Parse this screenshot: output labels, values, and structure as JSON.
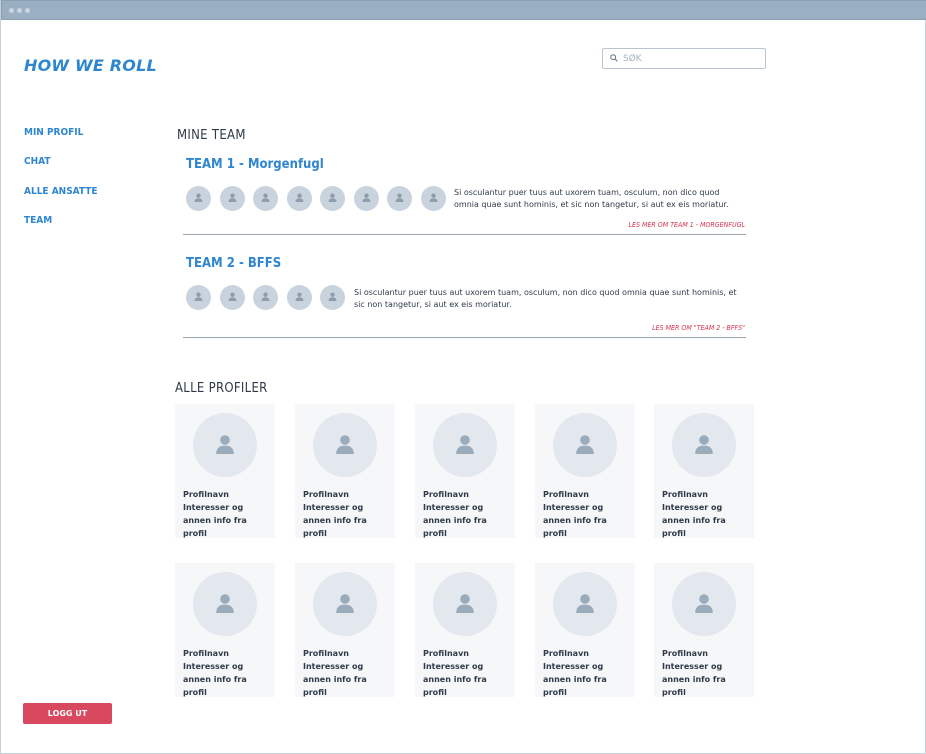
{
  "brand": "HOW WE ROLL",
  "search": {
    "placeholder": "SØK"
  },
  "nav": {
    "items": [
      {
        "label": "MIN PROFIL"
      },
      {
        "label": "CHAT"
      },
      {
        "label": "ALLE ANSATTE"
      },
      {
        "label": "TEAM"
      }
    ]
  },
  "my_teams": {
    "heading": "MINE TEAM",
    "teams": [
      {
        "title": "TEAM 1 - Morgenfugl",
        "member_count": 8,
        "description": "Si osculantur puer tuus aut uxorem tuam, osculum, non dico quod omnia quae sunt hominis, et sic non tangetur, si aut ex eis moriatur.",
        "link": "LES MER OM TEAM 1 - MORGENFUGL"
      },
      {
        "title": "TEAM 2 - BFFS",
        "member_count": 5,
        "description": "Si osculantur puer tuus aut uxorem tuam, osculum, non dico quod omnia quae sunt hominis, et sic non tangetur, si aut ex eis moriatur.",
        "link": "LES MER OM \"TEAM 2 - BFFS\""
      }
    ]
  },
  "all_profiles": {
    "heading": "ALLE PROFILER",
    "profiles": [
      {
        "name": "Profilnavn",
        "info": "Interesser og annen info fra profil"
      },
      {
        "name": "Profilnavn",
        "info": "Interesser og annen info fra profil"
      },
      {
        "name": "Profilnavn",
        "info": "Interesser og annen info fra profil"
      },
      {
        "name": "Profilnavn",
        "info": "Interesser og annen info fra profil"
      },
      {
        "name": "Profilnavn",
        "info": "Interesser og annen info fra profil"
      },
      {
        "name": "Profilnavn",
        "info": "Interesser og annen info fra profil"
      },
      {
        "name": "Profilnavn",
        "info": "Interesser og annen info fra profil"
      },
      {
        "name": "Profilnavn",
        "info": "Interesser og annen info fra profil"
      },
      {
        "name": "Profilnavn",
        "info": "Interesser og annen info fra profil"
      },
      {
        "name": "Profilnavn",
        "info": "Interesser og annen info fra profil"
      }
    ]
  },
  "logout_label": "LOGG UT",
  "colors": {
    "accent": "#2e86d0",
    "danger": "#d8485e",
    "link": "#d9334f",
    "titlebar": "#9aafc2"
  },
  "icons": {
    "search": "search-icon",
    "avatar": "user-icon"
  }
}
